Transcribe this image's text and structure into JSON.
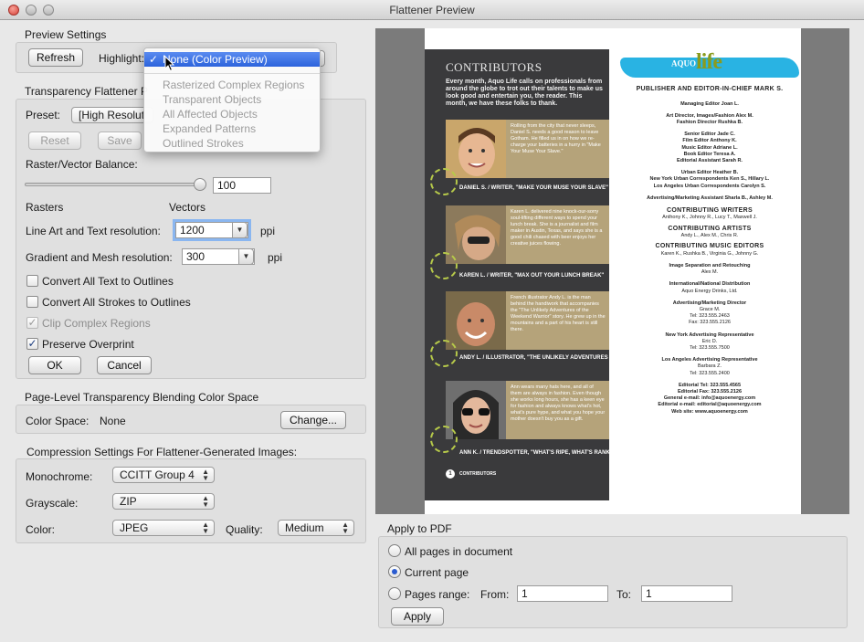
{
  "window": {
    "title": "Flattener Preview"
  },
  "preview_settings": {
    "section_label": "Preview Settings",
    "refresh_label": "Refresh",
    "highlight_label": "Highlight:",
    "highlight_menu": {
      "options": [
        "None (Color Preview)",
        "Rasterized Complex Regions",
        "Transparent Objects",
        "All Affected Objects",
        "Expanded Patterns",
        "Outlined Strokes"
      ],
      "selected": "None (Color Preview)",
      "check_mark": "✓"
    }
  },
  "transparency": {
    "section_label": "Transparency Flattener P",
    "preset_label": "Preset:",
    "preset_value": "[High Resolut",
    "reset_label": "Reset",
    "save_label": "Save",
    "balance_label": "Raster/Vector Balance:",
    "balance_value": "100",
    "balance_level": 100,
    "rasters_label": "Rasters",
    "vectors_label": "Vectors",
    "line_art_label": "Line Art and Text resolution:",
    "line_art_value": "1200",
    "gradient_label": "Gradient and Mesh resolution:",
    "gradient_value": "300",
    "ppi": "ppi",
    "convert_text_label": "Convert All Text to Outlines",
    "convert_strokes_label": "Convert All Strokes to Outlines",
    "clip_label": "Clip Complex Regions",
    "overprint_label": "Preserve Overprint",
    "ok_label": "OK",
    "cancel_label": "Cancel",
    "check_glyph": "✓"
  },
  "blending": {
    "section_label": "Page-Level Transparency Blending Color Space",
    "color_space_label": "Color Space:",
    "color_space_value": "None",
    "change_label": "Change..."
  },
  "compression": {
    "section_label": "Compression Settings For Flattener-Generated Images:",
    "monochrome_label": "Monochrome:",
    "monochrome_value": "CCITT Group 4",
    "grayscale_label": "Grayscale:",
    "grayscale_value": "ZIP",
    "color_label": "Color:",
    "color_value": "JPEG",
    "quality_label": "Quality:",
    "quality_value": "Medium"
  },
  "apply": {
    "section_label": "Apply to PDF",
    "all_pages_label": "All pages in document",
    "current_page_label": "Current page",
    "range_label": "Pages range:",
    "from_label": "From:",
    "from_value": "1",
    "to_label": "To:",
    "to_value": "1",
    "apply_label": "Apply"
  },
  "document": {
    "contributors_title": "CONTRIBUTORS",
    "intro": "Every month, Aquo Life calls on professionals from around the globe to trot out their talents to make us look good and entertain you, the reader. This month, we have these folks to thank.",
    "entries": [
      {
        "bio": "Rolling from the city that never sleeps, Daniel S. needs a good reason to leave Gotham. He filled us in on how we re-charge your batteries in a hurry in \"Make Your Muse Your Slave.\"",
        "caption": "DANIEL S. / WRITER, \"MAKE YOUR MUSE YOUR SLAVE\""
      },
      {
        "bio": "Karen L. delivered nine knock-our-sorry soul-lifting different ways to spend your lunch break. She is a journalist and film maker in Austin, Texas, and says she is a good chili chased with beer enjoys her creative juices flowing.",
        "caption": "KAREN L. / WRITER, \"MAX OUT YOUR LUNCH BREAK\""
      },
      {
        "bio": "French illustrator Andy L. is the man behind the handiwork that accompanies the \"The Unlikely Adventures of the Weekend Warrior\" story. He grew up in the mountains and a part of his heart is still there.",
        "caption": "ANDY L. / ILLUSTRATOR, \"THE UNLIKELY ADVENTURES OF THE WEEKEND WARRIOR\""
      },
      {
        "bio": "Ann wears many hats here, and all of them are always in fashion. Even though she works long hours, she has a keen eye for fashion and always knows what's hot, what's pure hype, and what you hope your mother doesn't buy you as a gift.",
        "caption": "ANN K. / TRENDSPOTTER, \"WHAT'S RIPE, WHAT'S RANK\""
      }
    ],
    "page_number": "1",
    "footer": "CONTRIBUTORS",
    "logo_small": "AQUO",
    "logo_big": "life",
    "masthead": [
      {
        "t": "PUBLISHER AND EDITOR-IN-CHIEF MARK S.",
        "s": "h"
      },
      {
        "t": "Managing Editor Joan L.",
        "s": "b"
      },
      {
        "t": "Art Director, Images/Fashion Alex M.",
        "s": "b"
      },
      {
        "t": "Fashion Director Rushka B.",
        "s": "b"
      },
      {
        "t": "Senior Editor Jade C.",
        "s": "b"
      },
      {
        "t": "Film Editor Anthony K.",
        "s": "b"
      },
      {
        "t": "Music Editor Adriane L.",
        "s": "b"
      },
      {
        "t": "Book Editor Teresa A.",
        "s": "b"
      },
      {
        "t": "Editorial Assistant Sarah R.",
        "s": "b"
      },
      {
        "t": "Urban Editor Heather B.",
        "s": "b"
      },
      {
        "t": "New York Urban Correspondents Ken S., Hillary L.",
        "s": "b"
      },
      {
        "t": "Los Angeles Urban Correspondents Carolyn S.",
        "s": "b"
      },
      {
        "t": "Advertising/Marketing Assistant Sharla B., Ashley M.",
        "s": "b"
      },
      {
        "t": "CONTRIBUTING WRITERS",
        "s": "h"
      },
      {
        "t": "Anthony K., Johnny R., Lucy T., Maxwell J.",
        "s": ""
      },
      {
        "t": "CONTRIBUTING ARTISTS",
        "s": "h"
      },
      {
        "t": "Andy L., Alex M., Chris R.",
        "s": ""
      },
      {
        "t": "CONTRIBUTING MUSIC EDITORS",
        "s": "h"
      },
      {
        "t": "Karen K., Rushka B., Virginia G., Johnny G.",
        "s": ""
      },
      {
        "t": "Image Separation and Retouching",
        "s": "b"
      },
      {
        "t": "Alex M.",
        "s": ""
      },
      {
        "t": "International/National Distribution",
        "s": "b"
      },
      {
        "t": "Aquo Energy Drinks, Ltd.",
        "s": ""
      },
      {
        "t": "Advertising/Marketing Director",
        "s": "b"
      },
      {
        "t": "Grace M.",
        "s": ""
      },
      {
        "t": "Tel: 323.555.2463",
        "s": ""
      },
      {
        "t": "Fax: 323.555.2126",
        "s": ""
      },
      {
        "t": "New York Advertising Representative",
        "s": "b"
      },
      {
        "t": "Eric D.",
        "s": ""
      },
      {
        "t": "Tel: 323.555.7500",
        "s": ""
      },
      {
        "t": "Los Angeles Advertising Representative",
        "s": "b"
      },
      {
        "t": "Barbara Z.",
        "s": ""
      },
      {
        "t": "Tel: 323.555.2400",
        "s": ""
      },
      {
        "t": "Editorial Tel: 323.555.4565",
        "s": "b"
      },
      {
        "t": "Editorial Fax: 323.555.2126",
        "s": "b"
      },
      {
        "t": "General e-mail: info@aquoenergy.com",
        "s": "b"
      },
      {
        "t": "Editorial e-mail: editorial@aquoenergy.com",
        "s": "b"
      },
      {
        "t": "Web site: www.aquoenergy.com",
        "s": "b"
      }
    ]
  },
  "colors": {
    "accent": "#2c63dc",
    "tan_box": "#b5a37a",
    "dark_column": "#3a3a3c",
    "masthead_blue": "#29b3e3",
    "logo_green": "#8a9b1e"
  }
}
